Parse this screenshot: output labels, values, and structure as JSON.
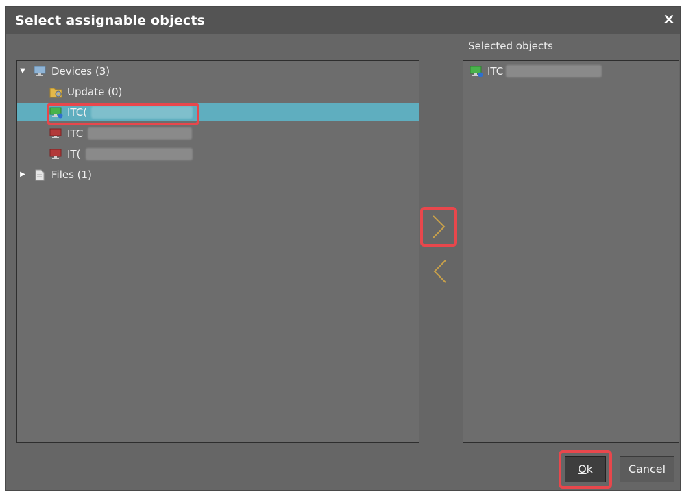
{
  "dialog": {
    "title": "Select assignable objects",
    "close_glyph": "×"
  },
  "selected_label": "Selected objects",
  "tree": {
    "devices": {
      "label": "Devices (3)",
      "icon": "monitor-icon",
      "expanded": true
    },
    "update": {
      "label": "Update (0)",
      "icon": "folder-gear-icon"
    },
    "device_items": [
      {
        "prefix": "ITC(",
        "icon": "monitor-green-icon",
        "selected": true
      },
      {
        "prefix": "ITC",
        "icon": "monitor-red-icon",
        "selected": false
      },
      {
        "prefix": "IT(",
        "icon": "monitor-red-icon",
        "selected": false
      }
    ],
    "files": {
      "label": "Files (1)",
      "icon": "file-icon",
      "expanded": false
    }
  },
  "selected_items": [
    {
      "prefix": "ITC",
      "icon": "monitor-green-icon"
    }
  ],
  "buttons": {
    "ok_mnemonic": "O",
    "ok_rest": "k",
    "cancel": "Cancel"
  },
  "colors": {
    "selection": "#5faebf",
    "highlight": "#e8474c",
    "arrow": "#c9a14a"
  }
}
